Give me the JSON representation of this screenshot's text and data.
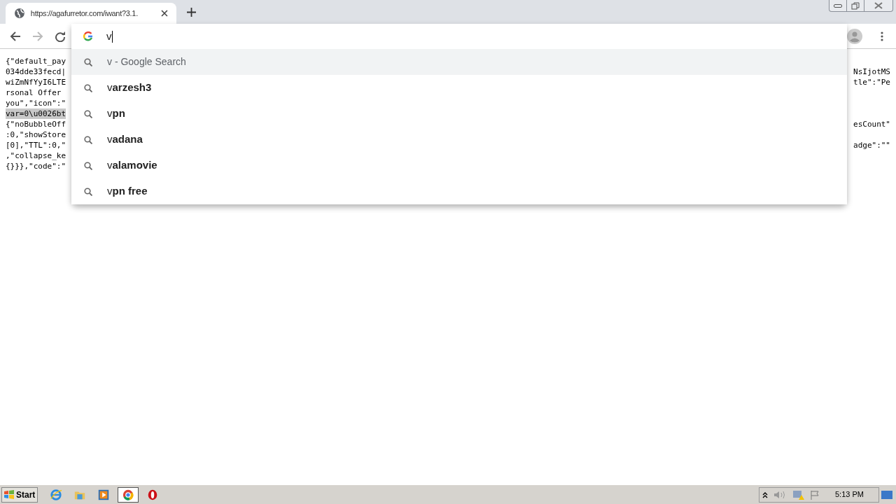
{
  "tab": {
    "title": "https://agafurretor.com/iwant?3.1."
  },
  "omnibox": {
    "value": "v"
  },
  "suggestions": [
    {
      "kind": "search",
      "text": "v - Google Search",
      "selected": true
    },
    {
      "kind": "query",
      "text": "v**arzesh3**",
      "selected": false
    },
    {
      "kind": "query",
      "text": "v**pn**",
      "selected": false
    },
    {
      "kind": "query",
      "text": "v**adana**",
      "selected": false
    },
    {
      "kind": "query",
      "text": "v**alamovie**",
      "selected": false
    },
    {
      "kind": "query",
      "text": "v**pn free**",
      "selected": false
    }
  ],
  "page_lines": [
    {
      "left": "{\"default_pay",
      "selected": false
    },
    {
      "left": "034dde33fecd|",
      "right": "NsIjotMS",
      "selected": false
    },
    {
      "left": "wiZmNfYyI6LTE",
      "right": "tle\":\"Pe",
      "selected": false
    },
    {
      "left": "rsonal Offer",
      "selected": false
    },
    {
      "left": "you\",\"icon\":\"",
      "selected": false
    },
    {
      "left": "var=0\\u0026bt",
      "selected": true
    },
    {
      "left": "{\"noBubbleOff",
      "right": "esCount\"",
      "selected": false
    },
    {
      "left": ":0,\"showStore",
      "selected": false
    },
    {
      "left": "[0],\"TTL\":0,\"",
      "right": "adge\":\"\"",
      "selected": false
    },
    {
      "left": ",\"collapse_ke",
      "selected": false
    },
    {
      "left": "{}}},\"code\":\"",
      "selected": false
    }
  ],
  "taskbar": {
    "start": "Start",
    "apps": [
      {
        "kind": "ie",
        "selected": false
      },
      {
        "kind": "folder",
        "selected": false
      },
      {
        "kind": "media",
        "selected": false
      },
      {
        "kind": "chrome",
        "selected": true
      },
      {
        "kind": "opera",
        "selected": false
      }
    ],
    "clock": "5:13 PM"
  }
}
